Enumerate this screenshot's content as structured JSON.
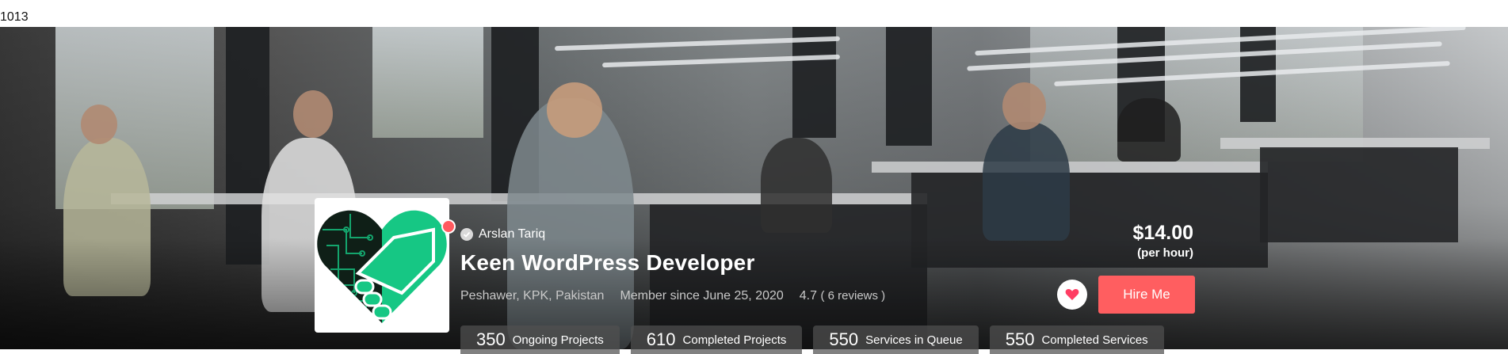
{
  "top_counter": "1013",
  "profile": {
    "user_name": "Arslan Tariq",
    "job_title": "Keen WordPress Developer",
    "location": "Peshawer, KPK, Pakistan",
    "member_since": "Member since June 25, 2020",
    "rating": "4.7",
    "reviews": "( 6 reviews )"
  },
  "price": {
    "amount": "$14.00",
    "unit": "(per hour)"
  },
  "actions": {
    "hire_label": "Hire Me",
    "favorite_icon": "heart-icon"
  },
  "stats": [
    {
      "value": "350",
      "label": "Ongoing Projects"
    },
    {
      "value": "610",
      "label": "Completed Projects"
    },
    {
      "value": "550",
      "label": "Services in Queue"
    },
    {
      "value": "550",
      "label": "Completed Services"
    }
  ],
  "colors": {
    "accent": "#ff5e60",
    "logo_green": "#16c784",
    "logo_dark": "#0f1f17"
  }
}
